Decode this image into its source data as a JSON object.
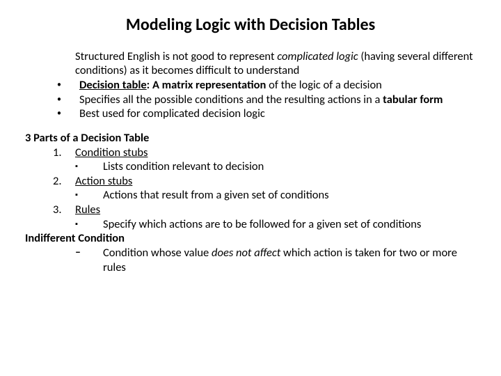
{
  "title": "Modeling Logic with Decision Tables",
  "intro_html": "Structured English is not good to represent <em>complicated logic</em> (having several different conditions) as it becomes difficult to understand",
  "bullets": [
    "<b><u>Decision table</u>: A matrix representation</b> of the logic of a decision",
    "Specifies all the possible conditions and the resulting actions in a <b>tabular form</b>",
    "Best used for complicated decision logic"
  ],
  "section_title": "3 Parts of a Decision Table",
  "parts": [
    {
      "label_html": "<u>Condition stubs</u>",
      "sub": "Lists condition relevant to decision"
    },
    {
      "label_html": "<u>Action stubs</u>",
      "sub": "Actions that result from a given set of conditions"
    },
    {
      "label_html": "<u>Rules</u>",
      "sub": "Specify which actions are to be followed for a given set of conditions"
    }
  ],
  "indifferent_title": "Indifferent Condition",
  "indifferent_sub_html": "Condition whose value <em>does not affect</em> which action is taken for two or more rules"
}
